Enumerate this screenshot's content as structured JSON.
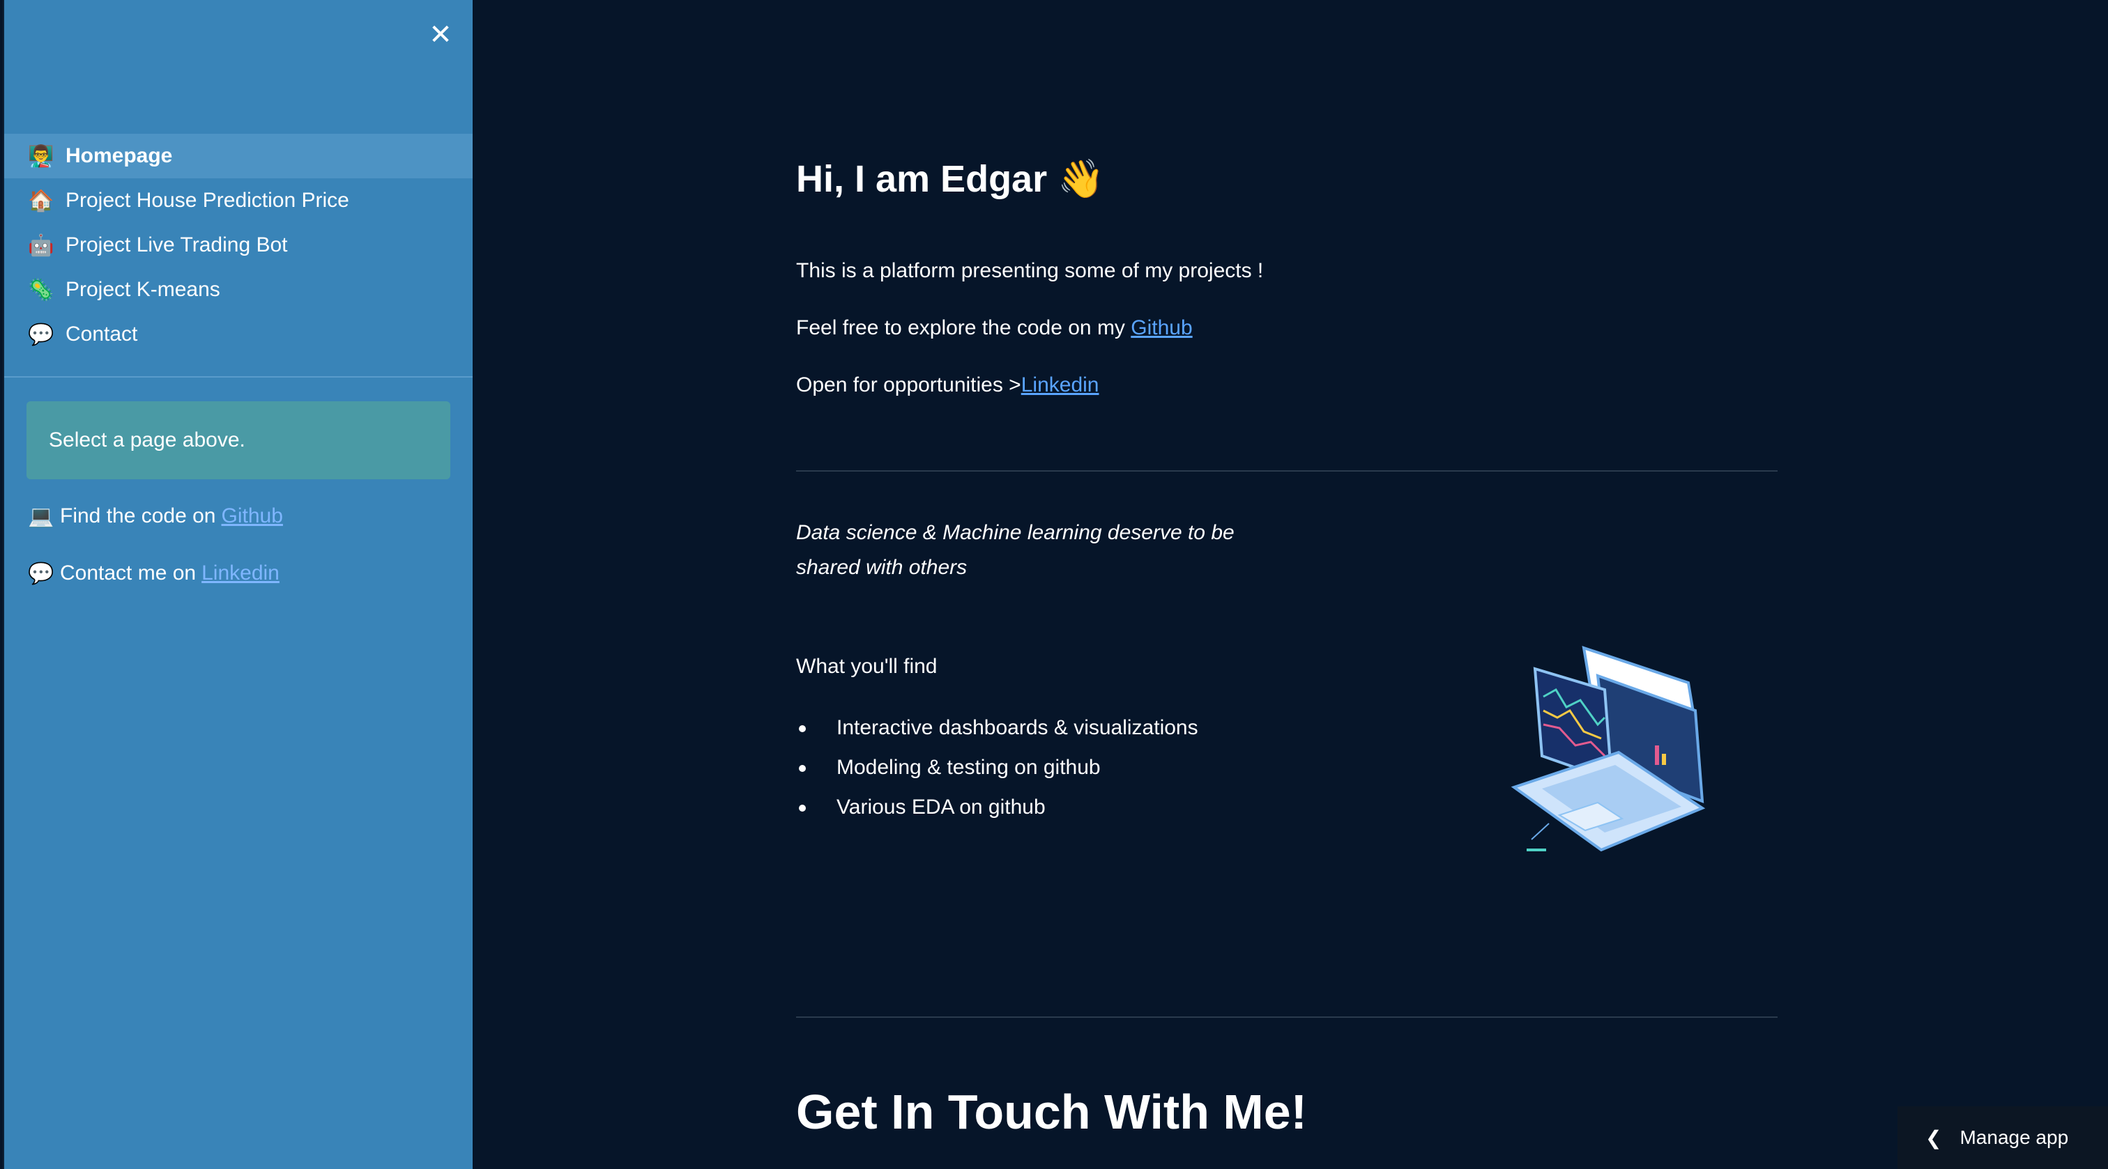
{
  "sidebar": {
    "close_icon": "close-icon",
    "nav_items": [
      {
        "label": "Homepage",
        "icon": "👨‍🏫",
        "active": true
      },
      {
        "label": "Project House Prediction Price",
        "icon": "🏠",
        "active": false
      },
      {
        "label": "Project Live Trading Bot",
        "icon": "🤖",
        "active": false
      },
      {
        "label": "Project K-means",
        "icon": "🦠",
        "active": false
      },
      {
        "label": "Contact",
        "icon": "💬",
        "active": false
      }
    ],
    "info_text": "Select a page above.",
    "code_line": {
      "icon": "💻",
      "text": "Find the code on",
      "link": "Github"
    },
    "contact_line": {
      "icon": "💬",
      "text": "Contact me on",
      "link": "Linkedin"
    }
  },
  "main": {
    "title": "Hi, I am Edgar 👋",
    "intro": "This is a platform presenting some of my projects !",
    "explore_text": "Feel free to explore the code on my ",
    "explore_link": "Github",
    "opportunities_text": "Open for opportunities >",
    "opportunities_link": "Linkedin",
    "quote": "Data science & Machine learning deserve to be shared with others",
    "find_heading": "What you'll find",
    "find_items": [
      "Interactive dashboards & visualizations",
      "Modeling & testing on github",
      "Various EDA on github"
    ],
    "contact_heading": "Get In Touch With Me!"
  },
  "footer": {
    "manage_app": "Manage app"
  },
  "colors": {
    "sidebar_bg": "#3984b8",
    "main_bg": "#061529",
    "link": "#5aa4ff",
    "info_box": "#4a9aa5"
  }
}
